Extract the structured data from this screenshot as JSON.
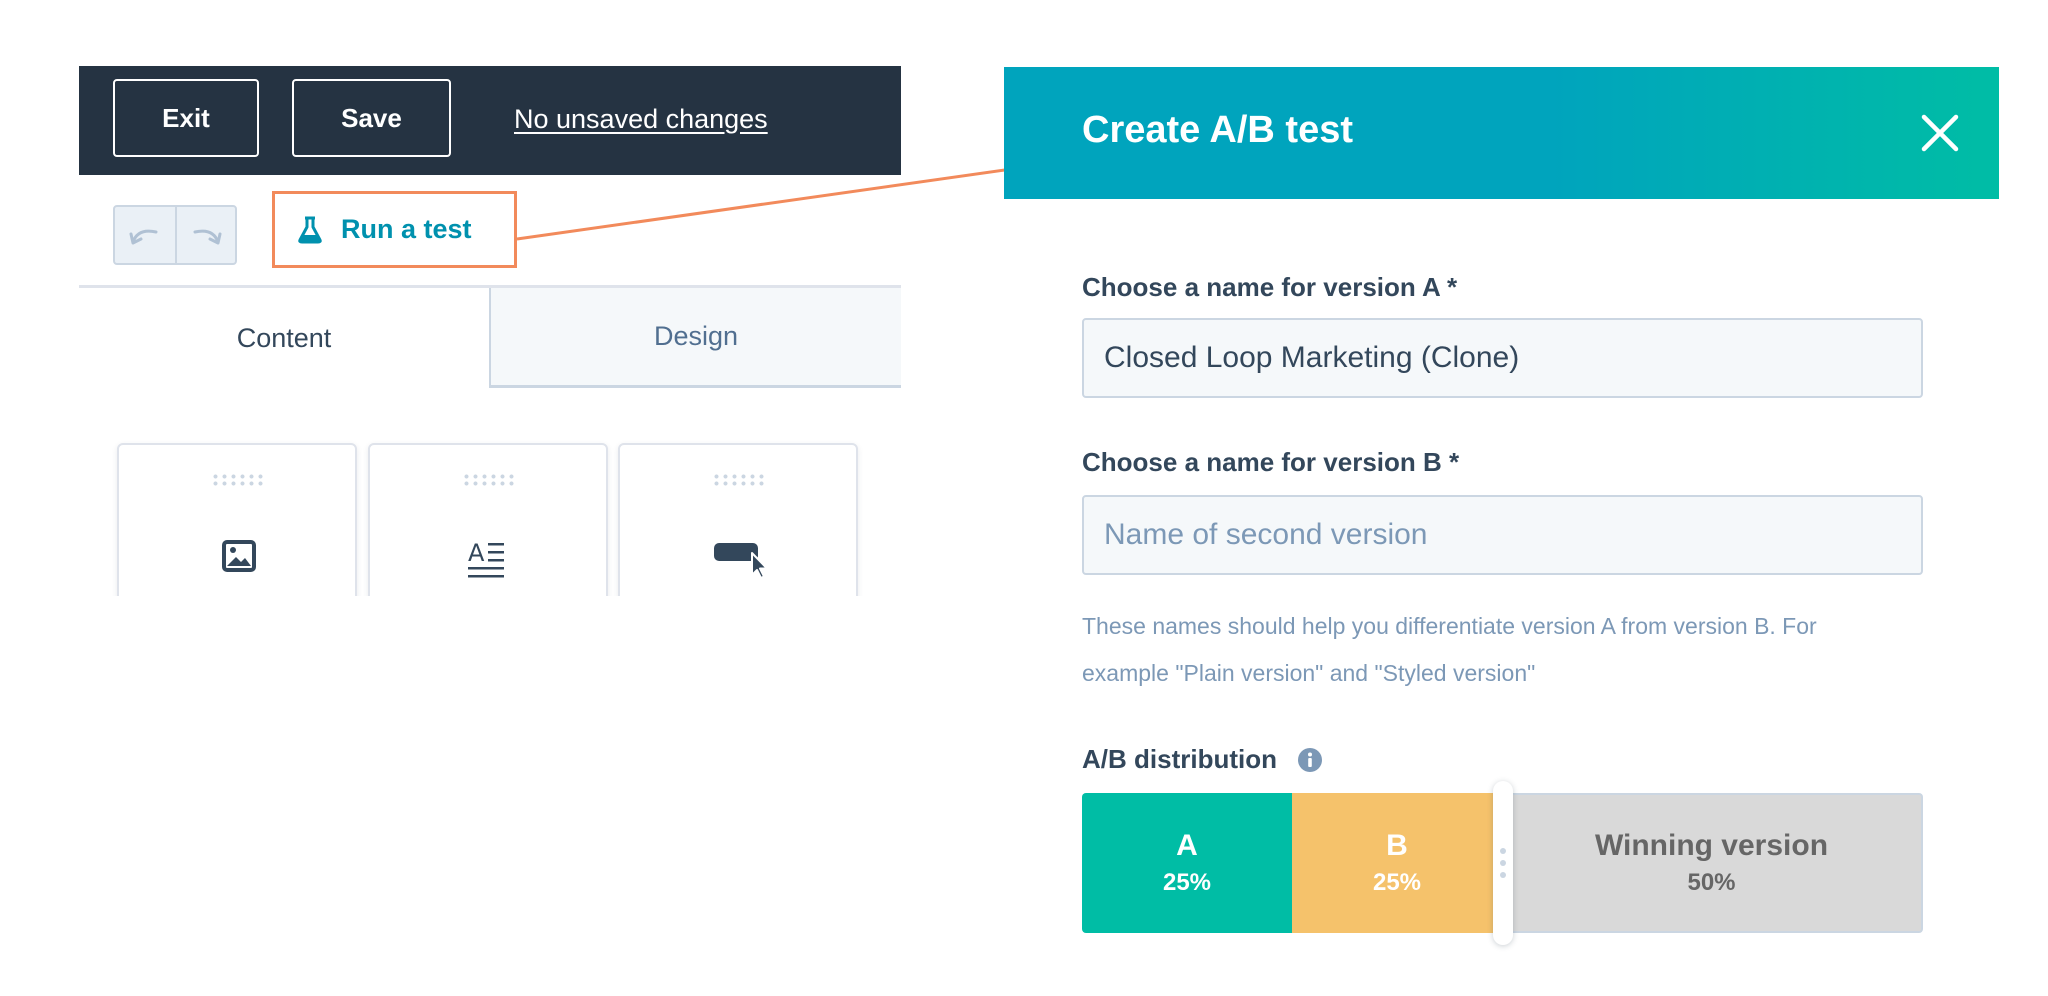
{
  "editor": {
    "exit_label": "Exit",
    "save_label": "Save",
    "unsaved_text": "No unsaved changes",
    "run_test_label": "Run a test",
    "tabs": [
      {
        "label": "Content",
        "active": true
      },
      {
        "label": "Design",
        "active": false
      }
    ],
    "module_icons": [
      "image-icon",
      "rich-text-icon",
      "button-cursor-icon"
    ]
  },
  "modal": {
    "title": "Create A/B test",
    "version_a": {
      "label": "Choose a name for version A *",
      "value": "Closed Loop Marketing (Clone)"
    },
    "version_b": {
      "label": "Choose a name for version B *",
      "value": "",
      "placeholder": "Name of second version"
    },
    "help_lines": [
      "These names should help you differentiate version A from version B. For",
      "example \"Plain version\" and \"Styled version\""
    ],
    "distribution": {
      "label": "A/B distribution",
      "segments": [
        {
          "name": "A",
          "percent": 25,
          "percent_label": "25%",
          "color": "#00bda5"
        },
        {
          "name": "B",
          "percent": 25,
          "percent_label": "25%",
          "color": "#f5c26b"
        },
        {
          "name": "Winning version",
          "percent": 50,
          "percent_label": "50%",
          "color": "#d9d9d9"
        }
      ]
    }
  },
  "colors": {
    "topbar": "#253342",
    "accent_teal": "#00a4bd",
    "accent_green": "#00bda5",
    "highlight_orange": "#f28a5b"
  }
}
